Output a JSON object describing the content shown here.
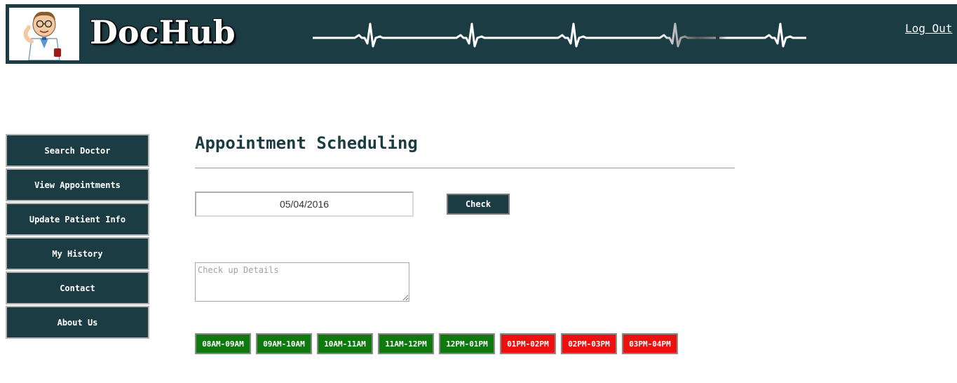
{
  "header": {
    "brand": "DocHub",
    "logout_label": "Log Out",
    "bg_color": "#1c3c44"
  },
  "sidebar": {
    "items": [
      {
        "label": "Search Doctor"
      },
      {
        "label": "View Appointments"
      },
      {
        "label": "Update Patient Info"
      },
      {
        "label": "My History"
      },
      {
        "label": "Contact"
      },
      {
        "label": "About Us"
      }
    ]
  },
  "main": {
    "title": "Appointment Scheduling",
    "date_value": "05/04/2016",
    "check_label": "Check",
    "details_placeholder": "Check up Details",
    "slots": [
      {
        "label": "08AM-09AM",
        "status": "available"
      },
      {
        "label": "09AM-10AM",
        "status": "available"
      },
      {
        "label": "10AM-11AM",
        "status": "available"
      },
      {
        "label": "11AM-12PM",
        "status": "available"
      },
      {
        "label": "12PM-01PM",
        "status": "available"
      },
      {
        "label": "01PM-02PM",
        "status": "booked"
      },
      {
        "label": "02PM-03PM",
        "status": "booked"
      },
      {
        "label": "03PM-04PM",
        "status": "booked"
      }
    ],
    "available_color": "#0e7a0e",
    "booked_color": "#ee0f0f"
  },
  "icons": {
    "logo": "doctor-mascot-icon",
    "banner": "heartbeat-line-icon"
  }
}
